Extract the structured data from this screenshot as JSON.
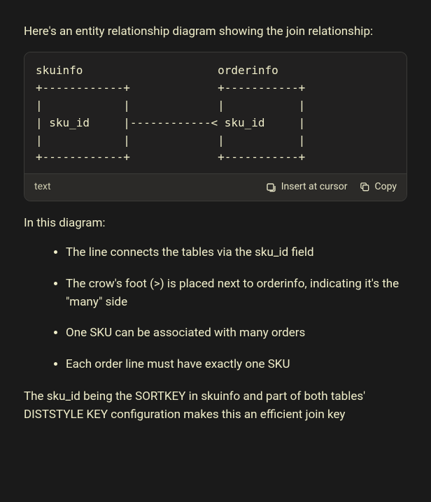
{
  "intro": "Here's an entity relationship diagram showing the join relationship:",
  "code": {
    "content": "skuinfo                    orderinfo\n+------------+             +-----------+\n|            |             |           |\n| sku_id     |------------< sku_id     |\n|            |             |           |\n+------------+             +-----------+",
    "lang": "text",
    "insert_label": "Insert at cursor",
    "copy_label": "Copy"
  },
  "section_lead": "In this diagram:",
  "bullets": [
    "The line connects the tables via the sku_id field",
    "The crow's foot (>) is placed next to orderinfo, indicating it's the \"many\" side",
    "One SKU can be associated with many orders",
    "Each order line must have exactly one SKU"
  ],
  "outro": "The sku_id being the SORTKEY in skuinfo and part of both tables' DISTSTYLE KEY configuration makes this an efficient join key"
}
